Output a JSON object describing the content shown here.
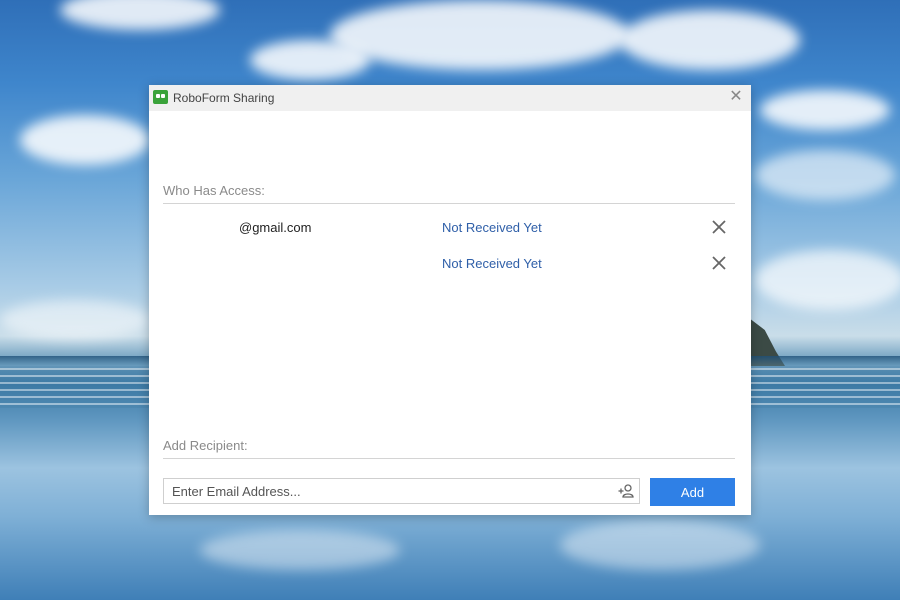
{
  "dialog": {
    "title": "RoboForm Sharing",
    "close_icon": "close-icon",
    "app_icon": "roboform-logo-icon"
  },
  "access": {
    "heading": "Who Has Access:",
    "entries": [
      {
        "email": "@gmail.com",
        "status": "Not Received Yet",
        "remove_icon": "remove-x-icon"
      },
      {
        "email": "",
        "status": "Not Received Yet",
        "remove_icon": "remove-x-icon"
      }
    ]
  },
  "recipient": {
    "heading": "Add Recipient:",
    "input_placeholder": "Enter Email Address...",
    "input_value": "",
    "contact_icon": "add-contact-icon",
    "add_label": "Add"
  },
  "colors": {
    "accent": "#2f80e6",
    "status_text": "#2f5fa8",
    "app_icon_green": "#3aa33a"
  }
}
